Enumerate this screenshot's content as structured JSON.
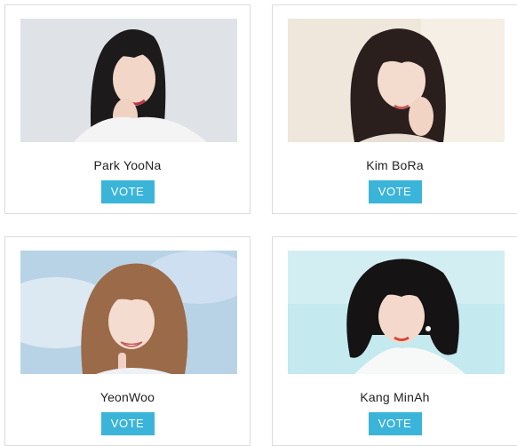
{
  "accent_color": "#3bb4d9",
  "candidates": [
    {
      "name": "Park YooNa",
      "vote_label": "VOTE",
      "photo_icon": "portrait-photo"
    },
    {
      "name": "Kim BoRa",
      "vote_label": "VOTE",
      "photo_icon": "portrait-photo"
    },
    {
      "name": "YeonWoo",
      "vote_label": "VOTE",
      "photo_icon": "portrait-photo"
    },
    {
      "name": "Kang MinAh",
      "vote_label": "VOTE",
      "photo_icon": "portrait-photo"
    }
  ]
}
